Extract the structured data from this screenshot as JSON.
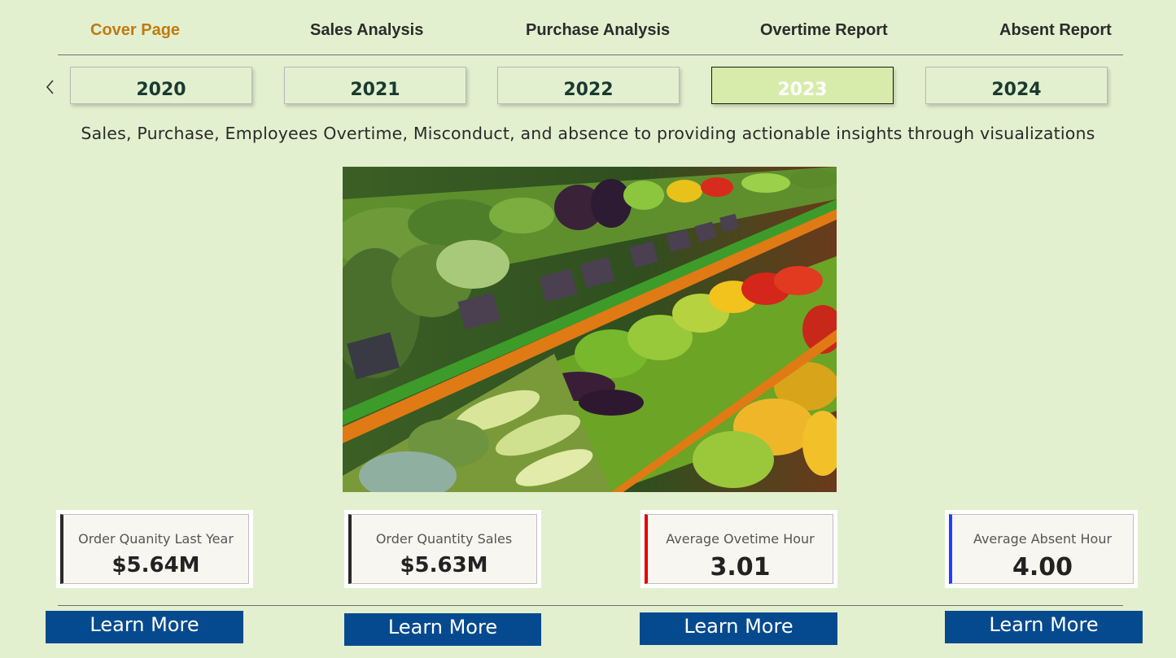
{
  "nav": {
    "items": [
      {
        "label": "Cover Page",
        "active": true
      },
      {
        "label": "Sales Analysis",
        "active": false
      },
      {
        "label": "Purchase Analysis",
        "active": false
      },
      {
        "label": "Overtime Report",
        "active": false
      },
      {
        "label": "Absent Report",
        "active": false
      }
    ],
    "active_color": "#c07a12"
  },
  "year_selector": {
    "back_icon": "chevron-left-icon",
    "years": [
      "2020",
      "2021",
      "2022",
      "2023",
      "2024"
    ],
    "selected": "2023"
  },
  "subtitle": "Sales, Purchase, Employees Overtime, Misconduct, and absence to providing actionable insights through visualizations",
  "hero_image": {
    "subject": "supermarket vegetable shelves"
  },
  "kpis": [
    {
      "label": "Order Quanity Last Year",
      "value": "$5.64M",
      "accent": "#2a2a2a"
    },
    {
      "label": "Order Quantity Sales",
      "value": "$5.63M",
      "accent": "#2a2a2a"
    },
    {
      "label": "Average Ovetime Hour",
      "value": "3.01",
      "accent": "#e60000"
    },
    {
      "label": "Average Absent Hour",
      "value": "4.00",
      "accent": "#1f3fff"
    }
  ],
  "buttons": [
    "Learn More",
    "Learn More",
    "Learn More",
    "Learn More"
  ],
  "colors": {
    "background": "#e2f0cf",
    "button": "#054a8f",
    "selected_year": "#d7ecaa"
  }
}
